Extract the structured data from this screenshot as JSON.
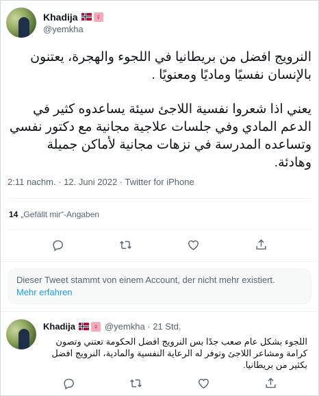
{
  "tweet": {
    "display_name": "Khadija",
    "handle": "@yemkha",
    "female_sign": "♀",
    "paragraphs": [
      "النرويج افضل من بريطانيا في اللجوء والهجرة، يعتنون بالإنسان نفسيًا وماديًا ومعنويًا .",
      "يعني اذا شعروا نفسية اللاجئ سيئة يساعدوه كثير في الدعم المادي وفي جلسات علاجية مجانية مع دكتور نفسي وتساعده المدرسة في نزهات مجانية لأماكن جميلة وهادئة."
    ],
    "meta": "2:11 nachm. · 12. Juni 2022 · Twitter for iPhone",
    "likes_count": "14",
    "likes_label": "„Gefällt mir“-Angaben"
  },
  "actions": [
    {
      "name": "reply-icon"
    },
    {
      "name": "retweet-icon"
    },
    {
      "name": "like-icon"
    },
    {
      "name": "share-icon"
    }
  ],
  "notice": {
    "text": "Dieser Tweet stammt von einem Account, der nicht mehr existiert.",
    "link": "Mehr erfahren"
  },
  "reply": {
    "display_name": "Khadija",
    "female_sign": "♀",
    "handle_time": "@yemkha · 21 Std.",
    "text": "اللجوء بشكل عام صعب جدًا بس النرويج افضل الحكومة تعتني وتصون كرامة ومشاعر اللاجئ وتوفر له الرعاية النفسية والمادية، النرويج افضل بكثير من بريطانيا."
  },
  "colors": {
    "text": "#0f1419",
    "secondary": "#536471",
    "link": "#1d9bf0",
    "divider": "#eff3f4"
  }
}
